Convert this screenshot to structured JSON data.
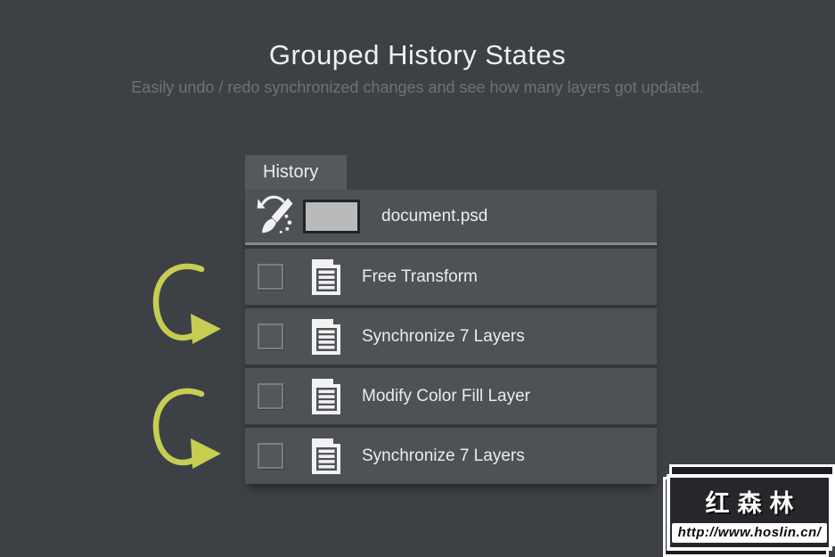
{
  "header": {
    "title": "Grouped History States",
    "subtitle": "Easily undo / redo synchronized changes and see how many layers got updated."
  },
  "panel": {
    "tab_label": "History",
    "document_state": {
      "label": "document.psd",
      "icon": "history-brush-icon",
      "thumbnail": "document-thumbnail"
    },
    "rows": [
      {
        "label": "Free Transform",
        "icon": "history-state-icon",
        "checked": false
      },
      {
        "label": "Synchronize 7 Layers",
        "icon": "history-state-icon",
        "checked": false
      },
      {
        "label": "Modify Color Fill Layer",
        "icon": "history-state-icon",
        "checked": false
      },
      {
        "label": "Synchronize 7 Layers",
        "icon": "history-state-icon",
        "checked": false
      }
    ]
  },
  "annotations": {
    "arrows": [
      {
        "name": "curved-arrow",
        "points_to": "Synchronize 7 Layers (row 2)"
      },
      {
        "name": "curved-arrow",
        "points_to": "Synchronize 7 Layers (row 4)"
      }
    ],
    "arrow_color": "#c7cd52"
  },
  "watermark": {
    "title": "红森林",
    "url": "http://www.hoslin.cn/"
  },
  "colors": {
    "page_bg": "#3d4045",
    "panel_row_bg": "#4e5156",
    "tab_bg": "#55585d",
    "divider": "#87898c",
    "accent_arrow": "#c7cd52",
    "text_primary": "#f0f0f1",
    "text_muted": "#6e7277"
  }
}
